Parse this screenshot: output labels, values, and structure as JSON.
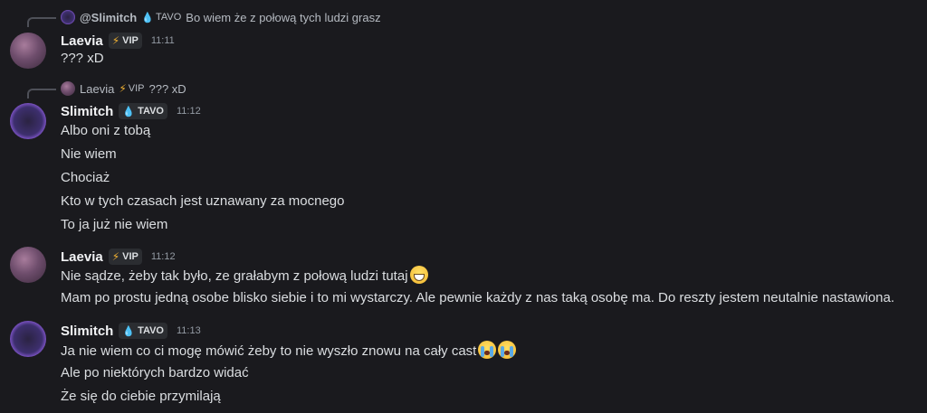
{
  "colors": {
    "background": "#1a1a1e",
    "username": "#f2f3f5",
    "message_text": "#dbdee1",
    "timestamp": "#949ba4",
    "badge_bg": "#2b2d31",
    "vip_icon": "#f0b132",
    "tavo_icon": "#7ab8e6"
  },
  "messages": [
    {
      "reply": {
        "author": "@Slimitch",
        "tag": "TAVO",
        "tag_icon": "droplet-icon",
        "text": "Bo wiem że z połową tych ludzi grasz"
      },
      "author": "Laevia",
      "badge": "VIP",
      "badge_icon": "lightning-icon",
      "time": "11:11",
      "lines": [
        "??? xD"
      ]
    },
    {
      "reply": {
        "author": "Laevia",
        "tag": "VIP",
        "tag_icon": "lightning-icon",
        "text": "??? xD"
      },
      "author": "Slimitch",
      "badge": "TAVO",
      "badge_icon": "droplet-icon",
      "time": "11:12",
      "lines": [
        "Albo oni z tobą",
        "Nie wiem",
        "Chociaż",
        "Kto w tych czasach jest uznawany za mocnego",
        "To ja już nie wiem"
      ]
    },
    {
      "author": "Laevia",
      "badge": "VIP",
      "badge_icon": "lightning-icon",
      "time": "11:12",
      "lines": [
        "Nie sądze, żeby tak było, ze grałabym z połową ludzi tutaj",
        "Mam po prostu jedną osobe blisko siebie i to mi wystarczy. Ale pewnie każdy z nas taką osobę ma. Do reszty jestem neutalnie nastawiona."
      ],
      "emojis": [
        "grinning-face-emoji"
      ]
    },
    {
      "author": "Slimitch",
      "badge": "TAVO",
      "badge_icon": "droplet-icon",
      "time": "11:13",
      "lines": [
        "Ja nie wiem co ci mogę mówić żeby to nie wyszło znowu na cały cast",
        "Ale po niektórych bardzo widać",
        "Że się do ciebie przymilają"
      ],
      "emojis": [
        "sobbing-face-emoji",
        "sobbing-face-emoji"
      ]
    }
  ]
}
